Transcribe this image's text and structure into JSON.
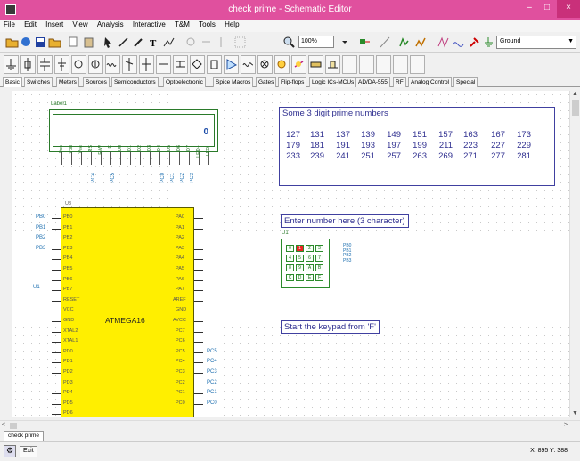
{
  "window": {
    "title": "check prime - Schematic Editor",
    "controls": {
      "minimize": "–",
      "maximize": "□",
      "close": "×"
    }
  },
  "menu": [
    "File",
    "Edit",
    "Insert",
    "View",
    "Analysis",
    "Interactive",
    "T&M",
    "Tools",
    "Help"
  ],
  "toolbar": {
    "zoom_value": "100%",
    "ground_select": "Ground"
  },
  "component_tabs": [
    "Basic",
    "Switches",
    "Meters",
    "Sources",
    "Semiconductors",
    "Optoelectronic",
    "Spice Macros",
    "Gates",
    "Flip-flops",
    "Logic ICs-MCUs",
    "AD/DA-555",
    "RF",
    "Analog Control",
    "Special"
  ],
  "canvas": {
    "lcd_label": "Label1",
    "lcd_digit": "0",
    "lcd_pins": [
      "Vss",
      "Vdd",
      "Vee",
      "RS",
      "R/W",
      "E",
      "D0",
      "D1",
      "D2",
      "D3",
      "D4",
      "D5",
      "D6",
      "D7",
      "LED+",
      "LED-"
    ],
    "lcd_port_labels": [
      "PC4",
      "PC5",
      "PC0",
      "PC1",
      "PC2",
      "PC3"
    ],
    "primes_title": "Some 3 digit prime numbers",
    "primes_rows": [
      [
        "127",
        "131",
        "137",
        "139",
        "149",
        "151",
        "157",
        "163",
        "167",
        "173"
      ],
      [
        "179",
        "181",
        "191",
        "193",
        "197",
        "199",
        "211",
        "223",
        "227",
        "229"
      ],
      [
        "233",
        "239",
        "241",
        "251",
        "257",
        "263",
        "269",
        "271",
        "277",
        "281"
      ]
    ],
    "mcu_ref": "U3",
    "mcu_name": "ATMEGA16",
    "mcu_left_pins": [
      "PB0",
      "PB1",
      "PB2",
      "PB3",
      "PB4",
      "PB5",
      "PB6",
      "PB7",
      "RESET",
      "VCC",
      "GND",
      "XTAL2",
      "XTAL1",
      "PD0",
      "PD1",
      "PD2",
      "PD3",
      "PD4",
      "PD5",
      "PD6"
    ],
    "mcu_right_pins": [
      "PA0",
      "PA1",
      "PA2",
      "PA3",
      "PA4",
      "PA5",
      "PA6",
      "PA7",
      "AREF",
      "GND",
      "AVCC",
      "PC7",
      "PC6",
      "PC5",
      "PC4",
      "PC3",
      "PC2",
      "PC1",
      "PC0"
    ],
    "mcu_left_nets": [
      "PB0",
      "PB1",
      "PB2",
      "PB3"
    ],
    "mcu_right_nets": [
      "PC5",
      "PC4",
      "PC3",
      "PC2",
      "PC1",
      "PC0"
    ],
    "u1_left_label": "U1",
    "enter_number": "Enter number here (3 character)",
    "keypad_ref": "U1",
    "keypad_keys": [
      "0",
      "1",
      "2",
      "3",
      "4",
      "5",
      "6",
      "7",
      "8",
      "9",
      "A",
      "B",
      "C",
      "D",
      "E",
      "F"
    ],
    "keypad_nets": [
      "PB0",
      "PB1",
      "PB2",
      "PB3"
    ],
    "start_keypad": "Start the keypad from 'F'"
  },
  "sheet_tab": "check prime",
  "status": {
    "exit_label": "Exit",
    "coords": "X: 895  Y: 388"
  }
}
